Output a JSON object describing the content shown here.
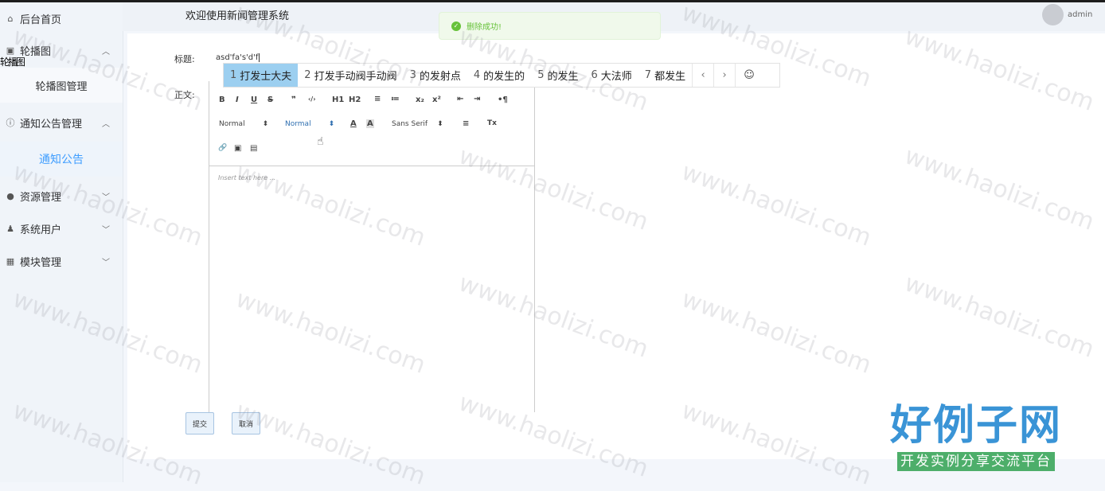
{
  "header": {
    "welcome": "欢迎使用新闻管理系统",
    "username": "admin"
  },
  "toast": {
    "message": "删除成功!"
  },
  "sidebar": {
    "overlap_text": "轮播图",
    "items": [
      {
        "label": "后台首页"
      },
      {
        "label": "轮播图"
      },
      {
        "label": "轮播图管理"
      },
      {
        "label": "通知公告管理"
      },
      {
        "label": "通知公告"
      },
      {
        "label": "资源管理"
      },
      {
        "label": "系统用户"
      },
      {
        "label": "模块管理"
      }
    ]
  },
  "form": {
    "title_label": "标题:",
    "title_value": "asd'fa's'd'f",
    "content_label": "正文:",
    "submit_label": "提交",
    "cancel_label": "取消"
  },
  "ime": {
    "candidates": [
      {
        "num": "1",
        "text": "打发士大夫"
      },
      {
        "num": "2",
        "text": "打发手动阀手动阀"
      },
      {
        "num": "3",
        "text": "的发射点"
      },
      {
        "num": "4",
        "text": "的发生的"
      },
      {
        "num": "5",
        "text": "的发生"
      },
      {
        "num": "6",
        "text": "大法师"
      },
      {
        "num": "7",
        "text": "都发生"
      }
    ],
    "prev": "‹",
    "next": "›",
    "emoji": "☺"
  },
  "editor": {
    "header_select": "Normal",
    "size_select": "Normal",
    "font_select": "Sans Serif",
    "placeholder": "Insert text here ...",
    "buttons": [
      "B",
      "I",
      "U",
      "S",
      "❞",
      "‹/›",
      "H1",
      "H2",
      "≡",
      "≔",
      "x₂",
      "x²",
      "⇤",
      "⇥",
      "•¶",
      "A",
      "A",
      "≡",
      "Tx",
      "🔗",
      "▣",
      "▤"
    ]
  },
  "watermark": {
    "text": "www.haolizi.com"
  },
  "logo": {
    "main": "好例子网",
    "sub": "开发实例分享交流平台"
  }
}
